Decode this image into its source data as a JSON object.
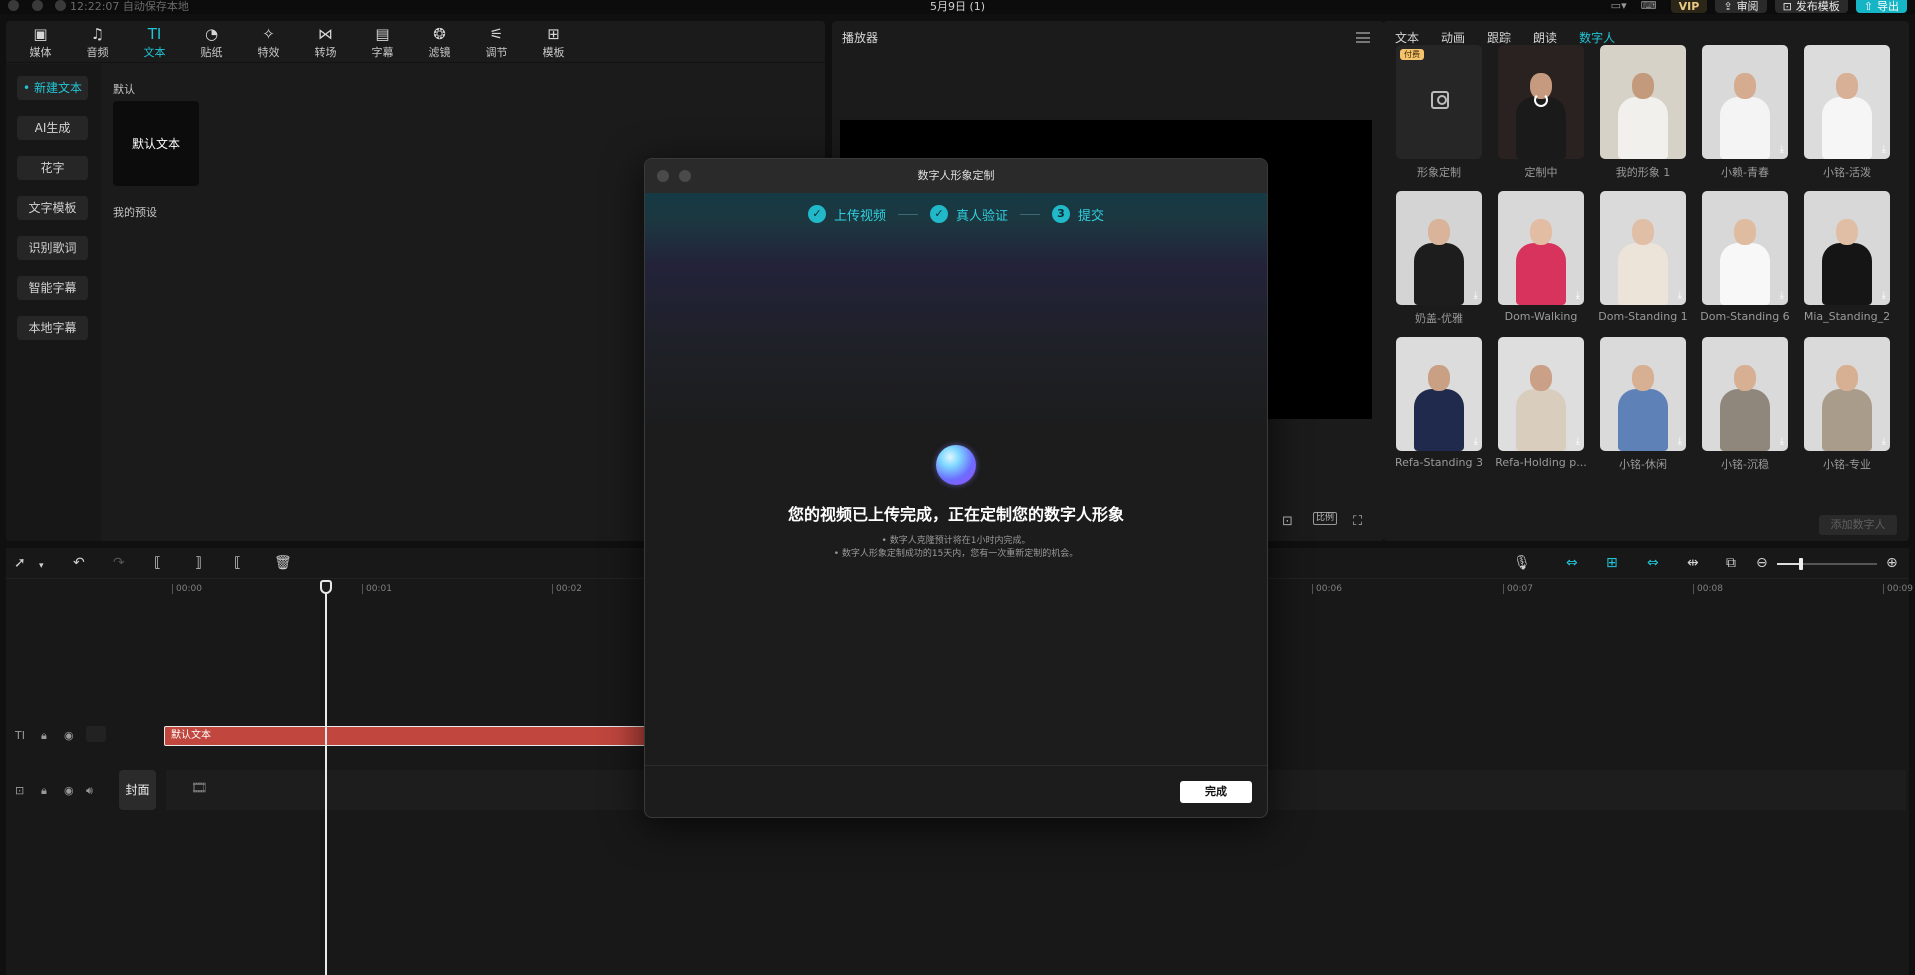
{
  "titlebar": {
    "status": "12:22:07 自动保存本地",
    "title": "5月9日 (1)",
    "vip_label": "VIP",
    "review_label": "审阅",
    "publish_label": "发布模板",
    "export_label": "导出"
  },
  "toolbar": {
    "tools": [
      {
        "icon": "▣",
        "label": "媒体"
      },
      {
        "icon": "♫",
        "label": "音频"
      },
      {
        "icon": "TI",
        "label": "文本"
      },
      {
        "icon": "◔",
        "label": "贴纸"
      },
      {
        "icon": "✧",
        "label": "特效"
      },
      {
        "icon": "⋈",
        "label": "转场"
      },
      {
        "icon": "▤",
        "label": "字幕"
      },
      {
        "icon": "❂",
        "label": "滤镜"
      },
      {
        "icon": "⚟",
        "label": "调节"
      },
      {
        "icon": "⊞",
        "label": "模板"
      }
    ],
    "active_index": 2
  },
  "sidebar": {
    "items": [
      "• 新建文本",
      "AI生成",
      "花字",
      "文字模板",
      "识别歌词",
      "智能字幕",
      "本地字幕"
    ]
  },
  "text_panel": {
    "default_label": "默认",
    "default_card": "默认文本",
    "presets_label": "我的预设"
  },
  "player": {
    "title": "播放器",
    "ratio_label": "比例"
  },
  "right_panel": {
    "tabs": [
      "文本",
      "动画",
      "跟踪",
      "朗读",
      "数字人"
    ],
    "active_tab": 4,
    "paid_badge": "付费",
    "avatars": [
      {
        "name": "形象定制"
      },
      {
        "name": "定制中"
      },
      {
        "name": "我的形象 1"
      },
      {
        "name": "小赖-青春"
      },
      {
        "name": "小铭-活泼"
      },
      {
        "name": "奶盖-优雅"
      },
      {
        "name": "Dom-Walking"
      },
      {
        "name": "Dom-Standing 1"
      },
      {
        "name": "Dom-Standing 6"
      },
      {
        "name": "Mia_Standing_2"
      },
      {
        "name": "Refa-Standing 3"
      },
      {
        "name": "Refa-Holding p..."
      },
      {
        "name": "小铭-休闲"
      },
      {
        "name": "小铭-沉稳"
      },
      {
        "name": "小铭-专业"
      }
    ],
    "add_button": "添加数字人"
  },
  "timeline": {
    "ticks": [
      "00:00",
      "00:01",
      "00:02",
      "00:06",
      "00:07",
      "00:08",
      "00:09"
    ],
    "text_clip": "默认文本",
    "cover_label": "封面"
  },
  "dialog": {
    "title": "数字人形象定制",
    "steps": [
      {
        "mark": "✓",
        "label": "上传视频"
      },
      {
        "mark": "✓",
        "label": "真人验证"
      },
      {
        "mark": "3",
        "label": "提交"
      }
    ],
    "main_text": "您的视频已上传完成，正在定制您的数字人形象",
    "note1": "• 数字人克隆预计将在1小时内完成。",
    "note2": "• 数字人形象定制成功的15天内，您有一次重新定制的机会。",
    "done_button": "完成"
  }
}
